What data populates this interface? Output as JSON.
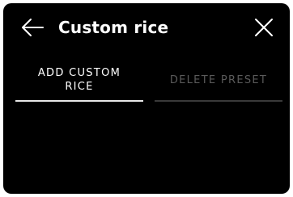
{
  "header": {
    "title": "Custom rice",
    "back_icon": "arrow-left-icon",
    "close_icon": "close-icon"
  },
  "tabs": [
    {
      "label": "ADD CUSTOM RICE",
      "active": true
    },
    {
      "label": "DELETE PRESET",
      "active": false
    }
  ],
  "colors": {
    "background": "#000000",
    "text": "#ffffff",
    "inactive_text": "#5a5a5a",
    "active_underline": "#e8e8e8",
    "inactive_underline": "#3a3a3a"
  }
}
